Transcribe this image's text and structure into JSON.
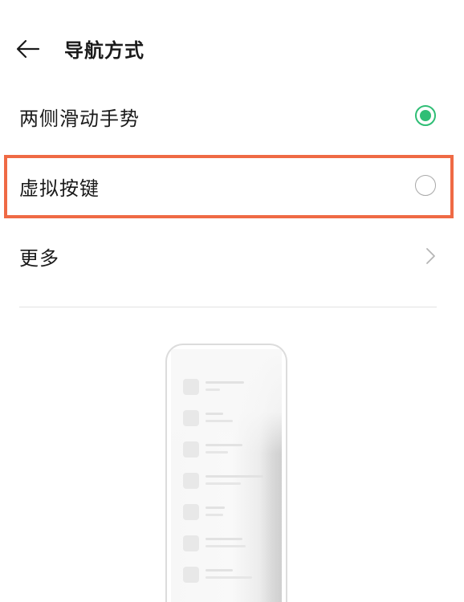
{
  "header": {
    "title": "导航方式",
    "back_icon": "arrow-left-icon"
  },
  "options": [
    {
      "label": "两侧滑动手势",
      "selected": true
    },
    {
      "label": "虚拟按键",
      "selected": false
    }
  ],
  "more": {
    "label": "更多",
    "icon": "chevron-right-icon"
  },
  "colors": {
    "accent": "#2fbe75",
    "highlight": "#ef6a45"
  }
}
